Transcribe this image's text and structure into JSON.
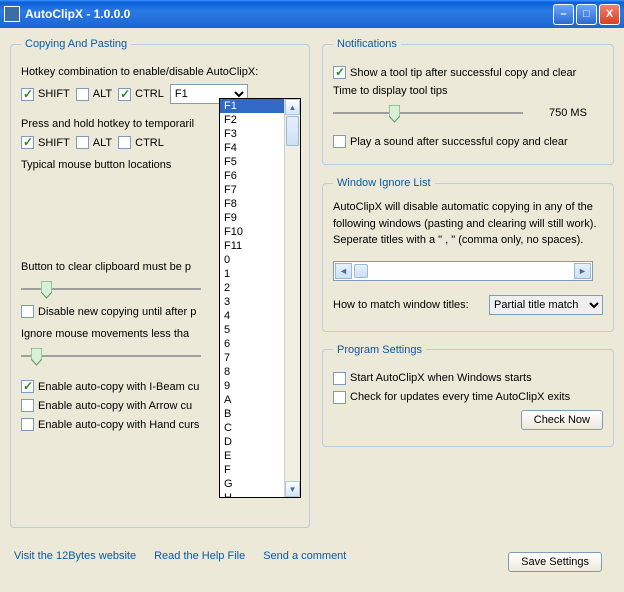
{
  "window": {
    "title": "AutoClipX - 1.0.0.0"
  },
  "copying": {
    "legend": "Copying And Pasting",
    "hotkeyLabel": "Hotkey combination to enable/disable AutoClipX:",
    "shift": "SHIFT",
    "alt": "ALT",
    "ctrl": "CTRL",
    "combo": "F1",
    "tempLabel": "Press and hold hotkey to temporaril",
    "typicalLabel": "Typical mouse button locations",
    "clearBtnLabel": "Button to clear clipboard must be p",
    "disableNew": "Disable new copying until after p",
    "ignoreMouse": "Ignore mouse movements less tha",
    "ibeam": "Enable auto-copy with I-Beam cu",
    "arrow": "Enable auto-copy with Arrow cu",
    "hand": "Enable auto-copy with Hand curs"
  },
  "dropdownItems": [
    "F1",
    "F2",
    "F3",
    "F4",
    "F5",
    "F6",
    "F7",
    "F8",
    "F9",
    "F10",
    "F11",
    "0",
    "1",
    "2",
    "3",
    "4",
    "5",
    "6",
    "7",
    "8",
    "9",
    "A",
    "B",
    "C",
    "D",
    "E",
    "F",
    "G",
    "H"
  ],
  "notifications": {
    "legend": "Notifications",
    "showTip": "Show a tool tip after successful copy and clear",
    "timeLabel": "Time to display tool tips",
    "ms": "750 MS",
    "playSound": "Play a sound after successful copy and clear"
  },
  "ignoreList": {
    "legend": "Window Ignore List",
    "note": "AutoClipX will disable automatic copying in any of the following windows (pasting and clearing will still work). Seperate titles with a \" , \" (comma only, no spaces).",
    "matchLabel": "How to match window titles:",
    "matchValue": "Partial title match"
  },
  "program": {
    "legend": "Program Settings",
    "startup": "Start AutoClipX when Windows starts",
    "updates": "Check for updates every time AutoClipX exits",
    "checkNow": "Check Now"
  },
  "footer": {
    "website": "Visit the 12Bytes website",
    "help": "Read the Help File",
    "comment": "Send a comment",
    "save": "Save Settings"
  }
}
